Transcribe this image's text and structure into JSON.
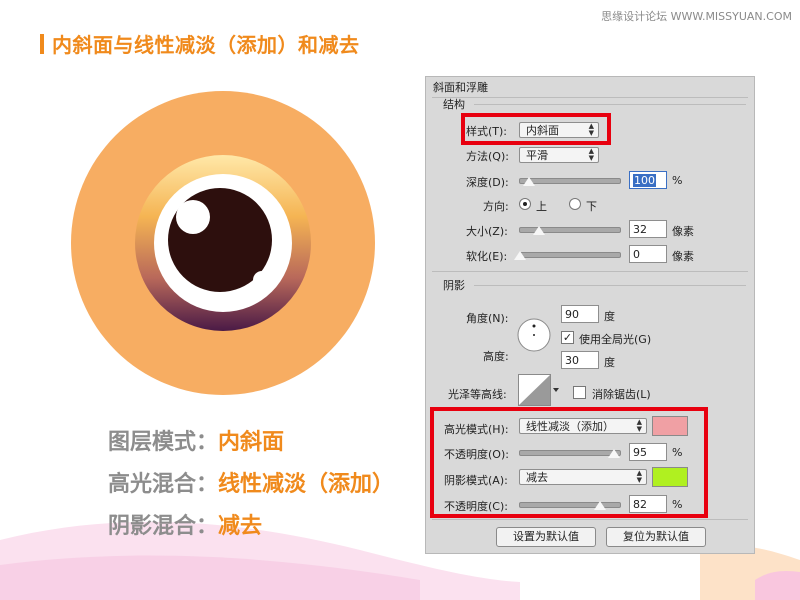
{
  "watermark": "思缘设计论坛 WWW.MISSYUAN.COM",
  "title": "内斜面与线性减淡（添加）和减去",
  "labels": [
    {
      "key": "图层模式：",
      "value": "内斜面"
    },
    {
      "key": "高光混合：",
      "value": "线性减淡（添加）"
    },
    {
      "key": "阴影混合：",
      "value": "减去"
    }
  ],
  "dialog": {
    "title": "斜面和浮雕",
    "structure": {
      "group_label": "结构",
      "style_label": "样式(T):",
      "style_value": "内斜面",
      "technique_label": "方法(Q):",
      "technique_value": "平滑",
      "depth_label": "深度(D):",
      "depth_value": "100",
      "depth_unit": "%",
      "direction_label": "方向:",
      "direction_up": "上",
      "direction_down": "下",
      "size_label": "大小(Z):",
      "size_value": "32",
      "size_unit": "像素",
      "soften_label": "软化(E):",
      "soften_value": "0",
      "soften_unit": "像素"
    },
    "shading": {
      "group_label": "阴影",
      "angle_label": "角度(N):",
      "angle_value": "90",
      "angle_unit": "度",
      "global_light_label": "使用全局光(G)",
      "altitude_label": "高度:",
      "altitude_value": "30",
      "altitude_unit": "度",
      "gloss_contour_label": "光泽等高线:",
      "anti_aliased_label": "消除锯齿(L)",
      "highlight_mode_label": "高光模式(H):",
      "highlight_mode_value": "线性减淡（添加）",
      "highlight_color": "#f0a0a4",
      "highlight_opacity_label": "不透明度(O):",
      "highlight_opacity_value": "95",
      "highlight_opacity_unit": "%",
      "shadow_mode_label": "阴影模式(A):",
      "shadow_mode_value": "减去",
      "shadow_color": "#b0f020",
      "shadow_opacity_label": "不透明度(C):",
      "shadow_opacity_value": "82",
      "shadow_opacity_unit": "%"
    },
    "buttons": {
      "set_default": "设置为默认值",
      "reset_default": "复位为默认值"
    }
  },
  "colors": {
    "accent_orange": "#f08a1c",
    "circle_orange": "#f7ad62",
    "label_gray": "#8d8d8d",
    "red_highlight": "#e8000f"
  }
}
